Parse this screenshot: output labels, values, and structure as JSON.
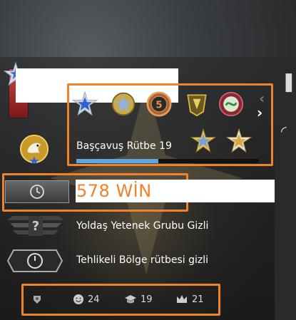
{
  "profile": {
    "rank_name": "Başçavuş Rütbe 19",
    "rank_progress": 0.45
  },
  "competitive": {
    "wins_text": "578 WİN"
  },
  "rows": {
    "wingman_text": "Yoldaş Yetenek Grubu Gizli",
    "danger_zone_text": "Tehlikeli Bölge rütbesi gizli"
  },
  "stats": {
    "commends_friendly": "24",
    "commends_teacher": "19",
    "commends_leader": "21"
  },
  "icons": {
    "medals": [
      "blue-star-medal",
      "silver-star-medal",
      "five-year-coin",
      "operation-medal",
      "green-snake-coin",
      "silver-star-medal-2",
      "gold-star-medal"
    ],
    "nav": [
      "chevron-left-icon",
      "chevron-right-icon"
    ]
  },
  "colors": {
    "highlight": "#f0822a",
    "progress": "#5aa9e6",
    "win_text": "#f0822a"
  }
}
